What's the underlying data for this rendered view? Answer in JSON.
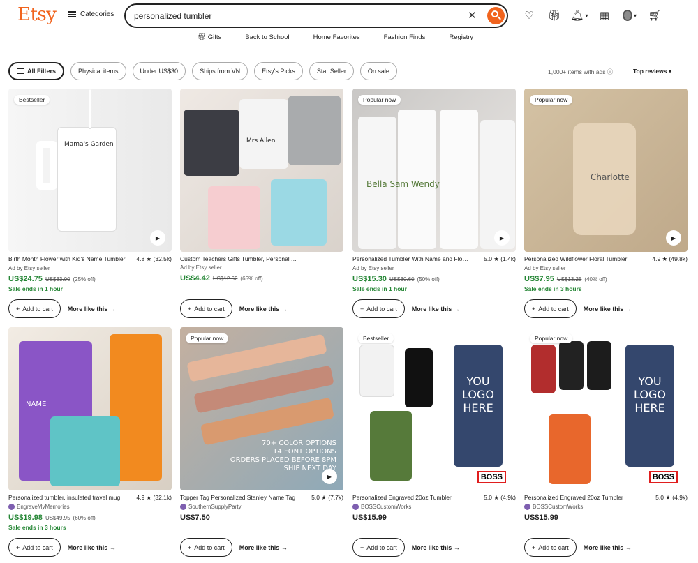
{
  "brand": {
    "logo": "Etsy",
    "categories": "Categories"
  },
  "search": {
    "value": "personalized tumbler"
  },
  "nav": [
    "Gifts",
    "Back to School",
    "Home Favorites",
    "Fashion Finds",
    "Registry"
  ],
  "filters": [
    "All Filters",
    "Physical items",
    "Under US$30",
    "Ships from VN",
    "Etsy's Picks",
    "Star Seller",
    "On sale"
  ],
  "results": {
    "count": "1,000+ items with ads ⓘ",
    "sort": "Top reviews ▾"
  },
  "actions": {
    "add": "Add to cart",
    "more": "More like this"
  },
  "products": [
    {
      "badge": "Bestseller",
      "title": "Birth Month Flower with Kid's Name Tumbler",
      "rating": "4.8 ★ (32.5k)",
      "seller": "Ad by Etsy seller",
      "price": "US$24.75",
      "old": "US$33.00",
      "off": "(25% off)",
      "sale": "Sale ends in 1 hour",
      "play": true,
      "img_text": "Mama's Garden"
    },
    {
      "badge": "",
      "title": "Custom Teachers Gifts Tumbler, Personalized",
      "rating": "",
      "seller": "Ad by Etsy seller",
      "price": "US$4.42",
      "old": "US$12.62",
      "off": "(65% off)",
      "sale": "",
      "play": false,
      "img_text": "Mrs Allen"
    },
    {
      "badge": "Popular now",
      "title": "Personalized Tumbler With Name and Flower",
      "rating": "5.0 ★ (1.4k)",
      "seller": "Ad by Etsy seller",
      "price": "US$15.30",
      "old": "US$30.60",
      "off": "(50% off)",
      "sale": "Sale ends in 1 hour",
      "play": true,
      "img_text": "Bella  Sam  Wendy"
    },
    {
      "badge": "Popular now",
      "title": "Personalized Wildflower Floral Tumbler",
      "rating": "4.9 ★ (49.8k)",
      "seller": "Ad by Etsy seller",
      "price": "US$7.95",
      "old": "US$13.25",
      "off": "(40% off)",
      "sale": "Sale ends in 3 hours",
      "play": true,
      "img_text": "Charlotte"
    },
    {
      "badge": "",
      "title": "Personalized tumbler, insulated travel mug",
      "rating": "4.9 ★ (32.1k)",
      "seller": "EngraveMyMemories",
      "price": "US$19.98",
      "old": "US$49.95",
      "off": "(60% off)",
      "sale": "Sale ends in 3 hours",
      "play": false,
      "img_text": "NAME"
    },
    {
      "badge": "Popular now",
      "title": "Topper Tag Personalized Stanley Name Tag",
      "rating": "5.0 ★ (7.7k)",
      "seller": "SouthernSupplyParty",
      "price": "US$7.50",
      "old": "",
      "off": "",
      "sale": "",
      "play": true,
      "img_text": "70+ COLOR OPTIONS\n14 FONT OPTIONS\nORDERS PLACED BEFORE 8PM\nSHIP NEXT DAY"
    },
    {
      "badge": "Bestseller",
      "title": "Personalized Engraved 20oz Tumbler",
      "rating": "5.0 ★ (4.9k)",
      "seller": "BOSSCustomWorks",
      "price": "US$15.99",
      "old": "",
      "off": "",
      "sale": "",
      "play": false,
      "img_text": "YOU\nLOGO\nHERE"
    },
    {
      "badge": "Popular now",
      "title": "Personalized Engraved 20oz Tumbler",
      "rating": "5.0 ★ (4.9k)",
      "seller": "BOSSCustomWorks",
      "price": "US$15.99",
      "old": "",
      "off": "",
      "sale": "",
      "play": false,
      "img_text": "YOU\nLOGO\nHERE"
    }
  ],
  "boss_label": "BOSS",
  "colors": {
    "brand": "#f1641e",
    "sale": "#258635"
  }
}
